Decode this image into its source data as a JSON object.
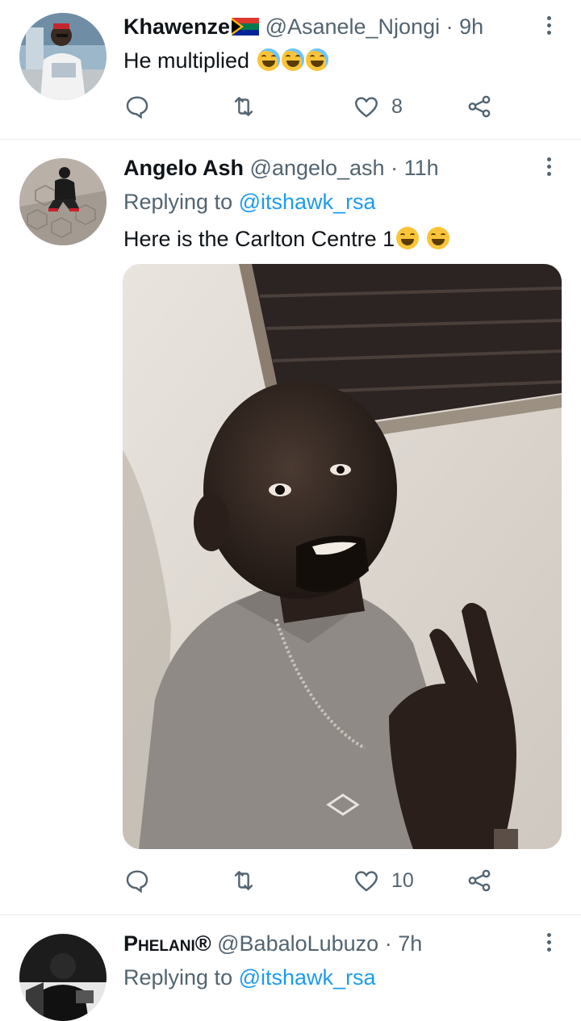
{
  "tweets": [
    {
      "name": "Khawenze",
      "handle": "@Asanele_Njongi",
      "sep": "·",
      "time": "9h",
      "text": "He multiplied",
      "text_emojis": [
        "face-with-tears-of-joy-icon",
        "face-with-tears-of-joy-icon",
        "face-with-tears-of-joy-icon"
      ],
      "replies": "",
      "retweets": "",
      "likes": "8",
      "avatar_icon": "user-avatar-photo"
    },
    {
      "name": "Angelo Ash",
      "handle": "@angelo_ash",
      "sep": "·",
      "time": "11h",
      "replying_prefix": "Replying to",
      "replying_to": "@itshawk_rsa",
      "text": "Here is the Carlton Centre 1",
      "text_emojis": [
        "grinning-face-icon",
        "grinning-face-icon"
      ],
      "replies": "",
      "retweets": "",
      "likes": "10",
      "avatar_icon": "user-avatar-photo"
    },
    {
      "name": "Phelani®",
      "handle": "@BabaloLubuzo",
      "sep": "·",
      "time": "7h",
      "replying_prefix": "Replying to",
      "replying_to": "@itshawk_rsa",
      "avatar_icon": "user-avatar-photo"
    }
  ],
  "colors": {
    "text_primary": "#0f1419",
    "text_secondary": "#536471",
    "link": "#1d9bf0",
    "divider": "#e6ecf0"
  },
  "icons": {
    "reply": "reply-icon",
    "retweet": "retweet-icon",
    "like": "heart-icon",
    "share": "share-icon",
    "more": "more-vertical-icon"
  }
}
